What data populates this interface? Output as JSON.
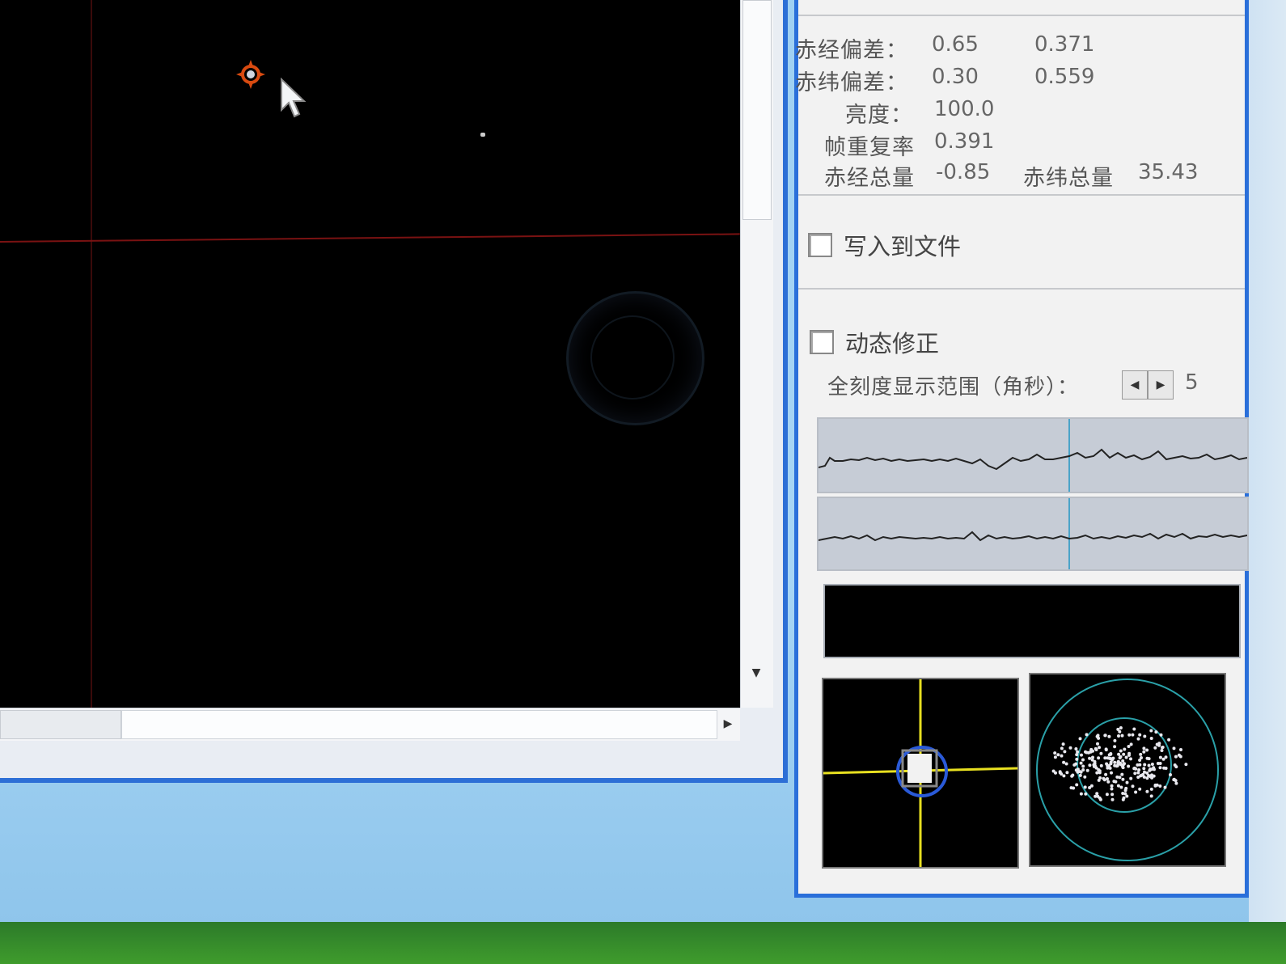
{
  "stats": {
    "ra_deviation_label": "赤经偏差：",
    "ra_deviation_value_1": "0.65",
    "ra_deviation_value_2": "0.371",
    "dec_deviation_label": "赤纬偏差：",
    "dec_deviation_value_1": "0.30",
    "dec_deviation_value_2": "0.559",
    "brightness_label": "亮度：",
    "brightness_value": "100.0",
    "frame_overlap_label": "帧重复率",
    "frame_overlap_value": "0.391",
    "ra_total_label": "赤经总量",
    "ra_total_value": "-0.85",
    "dec_total_label": "赤纬总量",
    "dec_total_value": "35.43"
  },
  "options": {
    "write_to_file_label": "写入到文件",
    "write_to_file_checked": false,
    "dynamic_correction_label": "动态修正",
    "dynamic_correction_checked": false,
    "scale_range_label": "全刻度显示范围（角秒）：",
    "scale_range_value": "5"
  },
  "colors": {
    "panel_border": "#2a6fda",
    "crosshair": "#e8e020",
    "marker": "#d84a10",
    "graph_bg": "#c6ccd6",
    "desktop": "#a8d6f5"
  },
  "icons": {
    "target": "target-marker-icon",
    "cursor": "cursor-arrow-icon",
    "scroll_down": "scroll-down-arrow-icon",
    "scroll_right": "scroll-right-arrow-icon",
    "spin_left": "spin-left-icon",
    "spin_right": "spin-right-icon"
  }
}
